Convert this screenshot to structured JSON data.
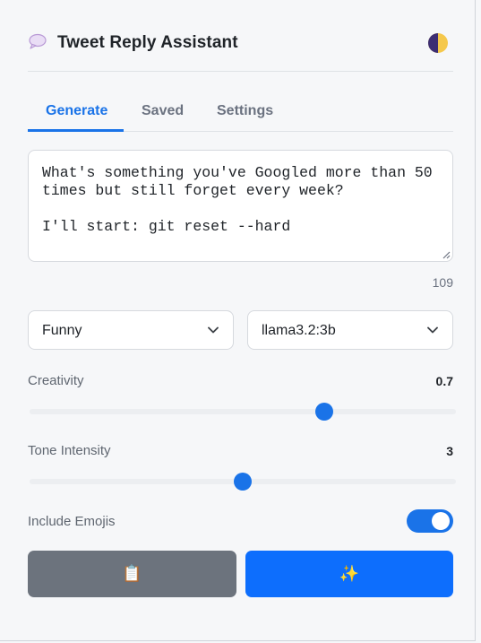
{
  "header": {
    "title": "Tweet Reply Assistant",
    "logo_icon": "speech-bubble-icon",
    "theme_icon": "half-moon-theme-toggle-icon"
  },
  "tabs": [
    {
      "label": "Generate",
      "active": true
    },
    {
      "label": "Saved",
      "active": false
    },
    {
      "label": "Settings",
      "active": false
    }
  ],
  "tweet_input": {
    "value": "What's something you've Googled more than 50 times but still forget every week?\n\nI'll start: git reset --hard",
    "char_count": "109"
  },
  "selects": {
    "tone": {
      "value": "Funny"
    },
    "model": {
      "value": "llama3.2:3b"
    }
  },
  "creativity": {
    "label": "Creativity",
    "value_text": "0.7",
    "value": 0.7,
    "min": 0,
    "max": 1
  },
  "tone_intensity": {
    "label": "Tone Intensity",
    "value_text": "3",
    "value": 3,
    "min": 1,
    "max": 5
  },
  "emojis": {
    "label": "Include Emojis",
    "enabled": true
  },
  "buttons": {
    "copy": {
      "glyph": "📋",
      "icon": "clipboard-icon"
    },
    "generate": {
      "glyph": "✨",
      "icon": "sparkles-icon"
    }
  },
  "colors": {
    "accent": "#1a73e8",
    "primary_button": "#0d6efd",
    "secondary_button": "#6c737d"
  }
}
